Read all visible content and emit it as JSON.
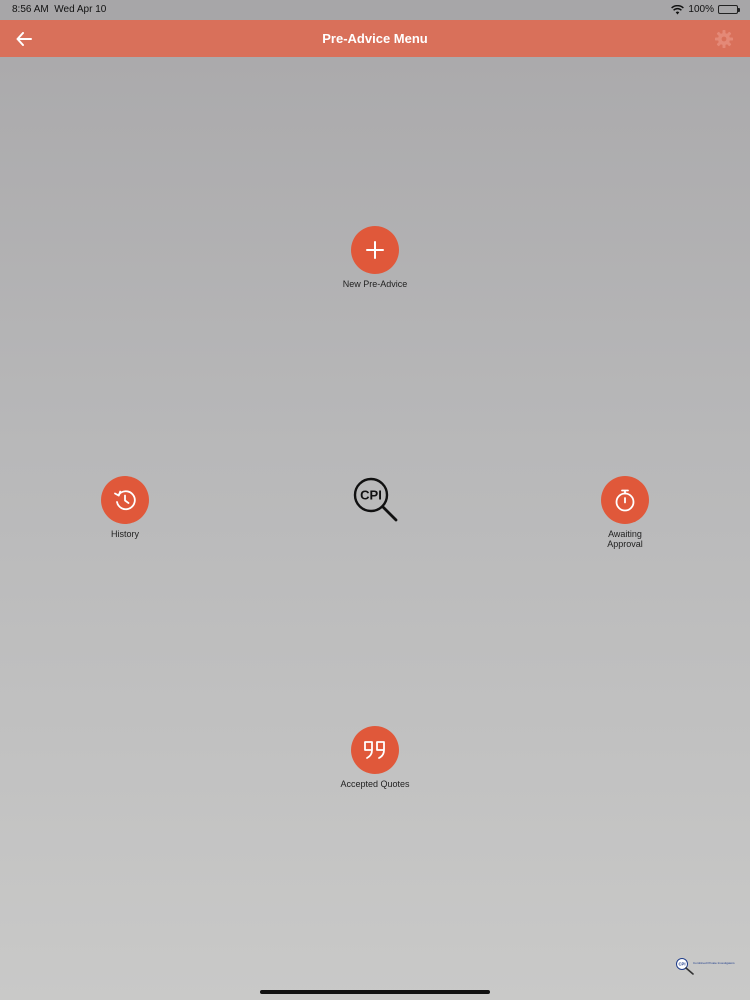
{
  "status_bar": {
    "time": "8:56 AM",
    "date": "Wed Apr 10",
    "battery": "100%",
    "icons": [
      "wifi-icon",
      "battery-icon"
    ]
  },
  "nav": {
    "title": "Pre-Advice Menu",
    "back_icon": "arrow-left-icon",
    "settings_icon": "gear-icon"
  },
  "menu": {
    "new_pre_advice": {
      "label": "New Pre-Advice",
      "icon": "plus-icon"
    },
    "history": {
      "label": "History",
      "icon": "history-icon"
    },
    "awaiting_approval": {
      "label": "Awaiting\nApproval",
      "icon": "stopwatch-icon"
    },
    "accepted_quotes": {
      "label": "Accepted Quotes",
      "icon": "quote-icon"
    }
  },
  "logo": {
    "text": "CPI"
  },
  "corner_logo": {
    "abbr": "CPI",
    "text": "Combined Private Investigators"
  },
  "colors": {
    "accent": "#e0583a",
    "nav_bar": "#d9705a",
    "background_top": "#a9a8aa",
    "background_bottom": "#c9c9c8"
  }
}
